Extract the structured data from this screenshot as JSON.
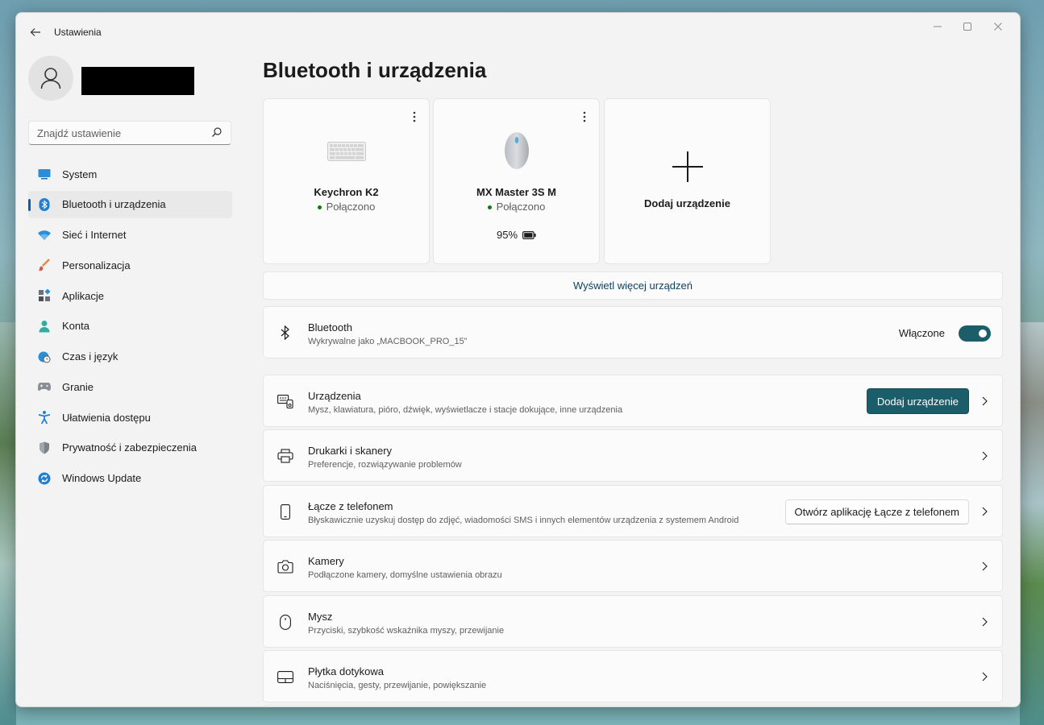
{
  "window": {
    "title": "Ustawienia",
    "back_icon": "arrow-left-icon"
  },
  "sidebar": {
    "search_placeholder": "Znajdź ustawienie",
    "items": [
      {
        "label": "System",
        "icon": "monitor-icon",
        "active": false
      },
      {
        "label": "Bluetooth i urządzenia",
        "icon": "bluetooth-icon",
        "active": true
      },
      {
        "label": "Sieć i Internet",
        "icon": "wifi-icon",
        "active": false
      },
      {
        "label": "Personalizacja",
        "icon": "brush-icon",
        "active": false
      },
      {
        "label": "Aplikacje",
        "icon": "apps-icon",
        "active": false
      },
      {
        "label": "Konta",
        "icon": "person-icon",
        "active": false
      },
      {
        "label": "Czas i język",
        "icon": "globe-clock-icon",
        "active": false
      },
      {
        "label": "Granie",
        "icon": "gamepad-icon",
        "active": false
      },
      {
        "label": "Ułatwienia dostępu",
        "icon": "accessibility-icon",
        "active": false
      },
      {
        "label": "Prywatność i zabezpieczenia",
        "icon": "shield-icon",
        "active": false
      },
      {
        "label": "Windows Update",
        "icon": "update-icon",
        "active": false
      }
    ]
  },
  "main": {
    "title": "Bluetooth i urządzenia",
    "devices": [
      {
        "name": "Keychron K2",
        "status": "Połączono",
        "icon": "keyboard-icon"
      },
      {
        "name": "MX Master 3S M",
        "status": "Połączono",
        "battery": "95%",
        "icon": "mouse-device-icon"
      }
    ],
    "add_device_card_label": "Dodaj urządzenie",
    "more_devices": "Wyświetl więcej urządzeń",
    "bluetooth": {
      "title": "Bluetooth",
      "subtitle": "Wykrywalne jako „MACBOOK_PRO_15”",
      "toggle_label": "Włączone",
      "toggle_on": true
    },
    "rows": [
      {
        "title": "Urządzenia",
        "subtitle": "Mysz, klawiatura, pióro, dźwięk, wyświetlacze i stacje dokujące, inne urządzenia",
        "icon": "devices-icon",
        "button": "Dodaj urządzenie"
      },
      {
        "title": "Drukarki i skanery",
        "subtitle": "Preferencje, rozwiązywanie problemów",
        "icon": "printer-icon"
      },
      {
        "title": "Łącze z telefonem",
        "subtitle": "Błyskawicznie uzyskuj dostęp do zdjęć, wiadomości SMS i innych elementów urządzenia z systemem Android",
        "icon": "phone-icon",
        "button": "Otwórz aplikację Łącze z telefonem"
      },
      {
        "title": "Kamery",
        "subtitle": "Podłączone kamery, domyślne ustawienia obrazu",
        "icon": "camera-icon"
      },
      {
        "title": "Mysz",
        "subtitle": "Przyciski, szybkość wskaźnika myszy, przewijanie",
        "icon": "mouse-icon"
      },
      {
        "title": "Płytka dotykowa",
        "subtitle": "Naciśnięcia, gesty, przewijanie, powiększanie",
        "icon": "touchpad-icon"
      }
    ]
  },
  "colors": {
    "accent": "#1b5e6a",
    "status_connected": "#0f7b0f",
    "nav_indicator": "#005fb8"
  }
}
